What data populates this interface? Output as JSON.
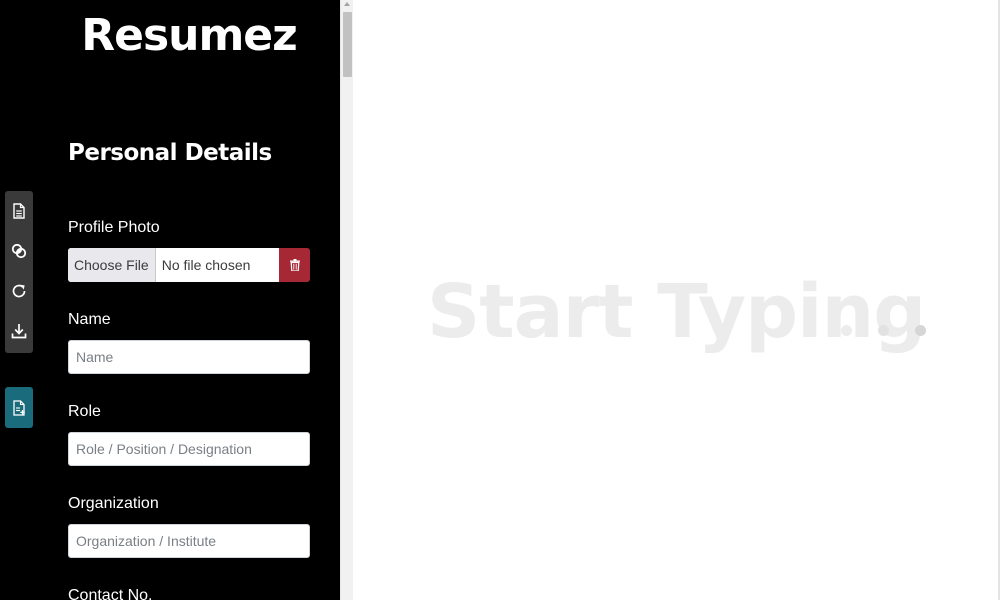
{
  "app": {
    "title": "Resumez"
  },
  "editor": {
    "section_title": "Personal Details",
    "profile_photo": {
      "label": "Profile Photo",
      "choose_label": "Choose File",
      "status": "No file chosen",
      "delete_icon": "trash-icon"
    },
    "fields": [
      {
        "label": "Name",
        "placeholder": "Name",
        "value": ""
      },
      {
        "label": "Role",
        "placeholder": "Role / Position / Designation",
        "value": ""
      },
      {
        "label": "Organization",
        "placeholder": "Organization / Institute",
        "value": ""
      },
      {
        "label": "Contact No.",
        "placeholder": "",
        "value": ""
      }
    ]
  },
  "toolbar": {
    "items": [
      {
        "icon": "document-icon"
      },
      {
        "icon": "link-icon"
      },
      {
        "icon": "refresh-icon"
      },
      {
        "icon": "download-icon"
      }
    ],
    "template_icon": "document-add-icon"
  },
  "preview": {
    "placeholder": "Start Typing",
    "dots_count": 3
  },
  "colors": {
    "sidebar_bg": "#000000",
    "toolbar_bg": "#3a3a3a",
    "template_button_bg": "#1a6b7c",
    "delete_button_bg": "#a52834",
    "placeholder_text": "#ececec"
  }
}
